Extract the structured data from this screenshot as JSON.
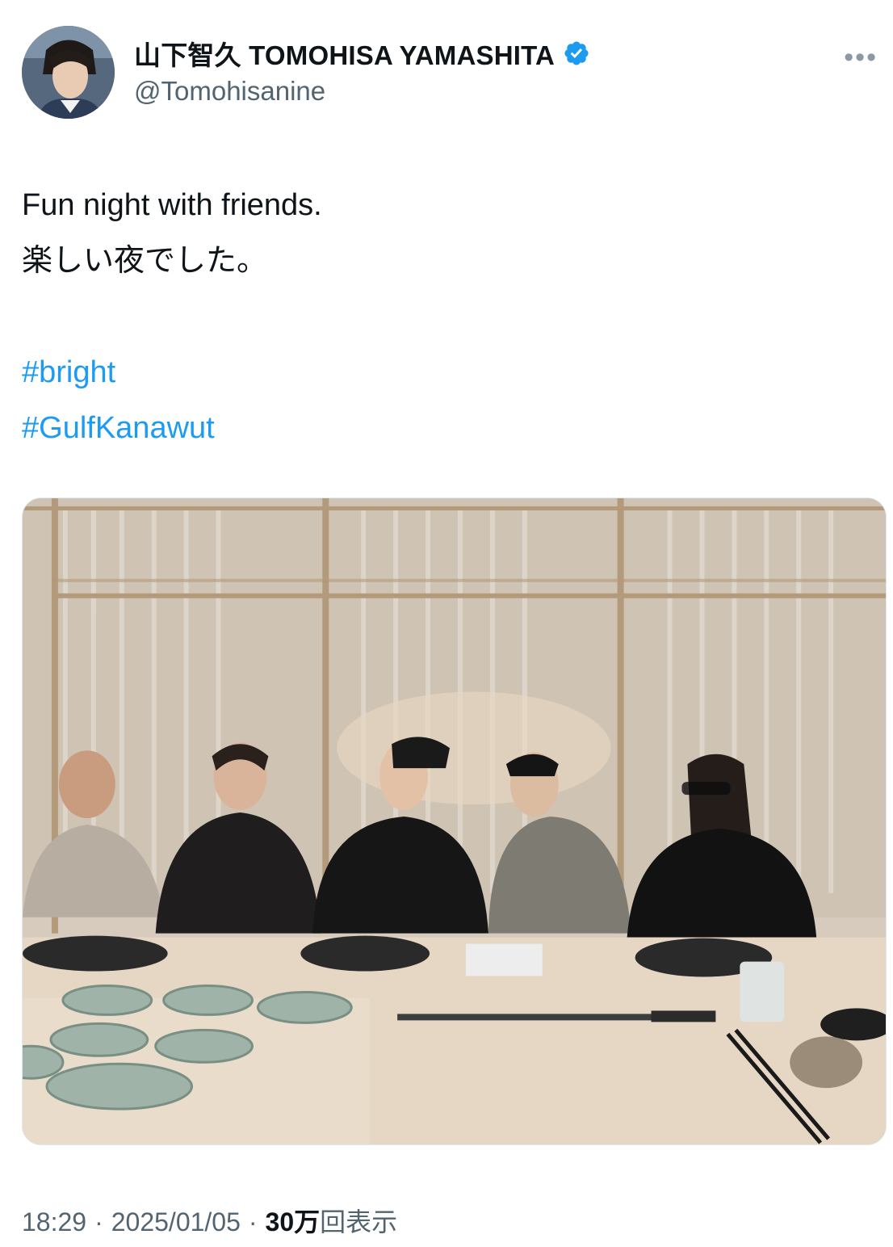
{
  "author": {
    "display_name": "山下智久 TOMOHISA YAMASHITA",
    "handle": "@Tomohisanine",
    "verified": true,
    "verified_color": "#1d9bf0"
  },
  "more_icon": "more-horizontal-icon",
  "tweet": {
    "lines": [
      "Fun night with friends.",
      "楽しい夜でした。"
    ],
    "hashtags": [
      "#bright",
      "#GulfKanawut"
    ]
  },
  "meta": {
    "time": "18:29",
    "date": "2025/01/05",
    "views_count": "30万",
    "views_label": "回表示",
    "separator": "·"
  },
  "colors": {
    "link": "#1d9bf0",
    "secondary_text": "#536471"
  }
}
